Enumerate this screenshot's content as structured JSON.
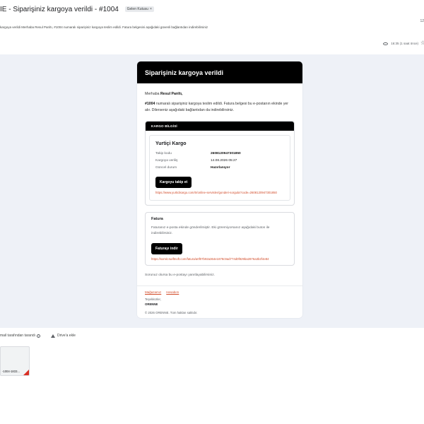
{
  "subject": {
    "title": "IE - Siparişiniz kargoya verildi - #1004",
    "label": "Gelen Kutusu",
    "label_x": "×",
    "page_counter": "12"
  },
  "snippet": "kargoya verildi Merhaba Resul Parıltı, #1004 numaralı siparişiniz kargoya teslim edildi. Fatura belgesini aşağıdaki güvenli bağlantıdan indirebilirsiniz",
  "meta": {
    "time": "16:35 (1 saat önce)"
  },
  "email": {
    "header_title": "Siparişiniz kargoya verildi",
    "greeting_prefix": "Merhaba",
    "customer_name": "Resul Parıltı,",
    "order_number": "#1004",
    "intro_text": "numaralı siparişiniz kargoya teslim edildi. Fatura belgesi bu e-postanın ekinde yer alır. Dilerseniz aşağıdaki bağlantıdan da indirebilirsiniz.",
    "shipping": {
      "section_label": "KARGO BİLGİSİ",
      "carrier": "Yurtiçi Kargo",
      "rows": [
        {
          "key": "Takip kodu",
          "value": "2608120947301850"
        },
        {
          "key": "Kargoya veriliş",
          "value": "14.08.2026 05:27"
        },
        {
          "key": "Güncel durum",
          "value": "Hazırlanıyor"
        }
      ],
      "button": "Kargoyu takip et",
      "url": "https://www.yurticikargo.com/tr/online-servisler/gonderi-sorgula?code=2608120947301850"
    },
    "invoice": {
      "title": "Fatura",
      "text": "Faturanız e-posta ekinde gönderilmiştir. Eki göremiyorsanız aşağıdaki buton ile indirebilirsiniz.",
      "button": "Faturayı indir",
      "url": "https://somit.swiftnoft.com/fatura/a0f07b92a364e1878c9ad774d0f829ba2876a3b2f4e84"
    },
    "question": "Sorunuz olursa bu e-postayı yanıtlayabilirsiniz.",
    "footer": {
      "link_store": "Mağazamız",
      "link_account": "Hesabım",
      "regards": "Teşekkürler,",
      "brand": "ORENNE",
      "copyright": "© 2026 ORENNE. Tüm hakları saklıdır."
    }
  },
  "attachments": {
    "scan_text": "mail tarafından tarandı",
    "drive_text": "Drive'a ekle",
    "file_name": "-1004-1833..."
  },
  "icons": {
    "eye": "eye-icon",
    "star": "star-icon",
    "info": "info-icon",
    "drive": "drive-icon",
    "pdf": "pdf-icon"
  },
  "colors": {
    "header_bg": "#000000",
    "link": "#d24c2a",
    "email_bg": "#eef1f7"
  }
}
